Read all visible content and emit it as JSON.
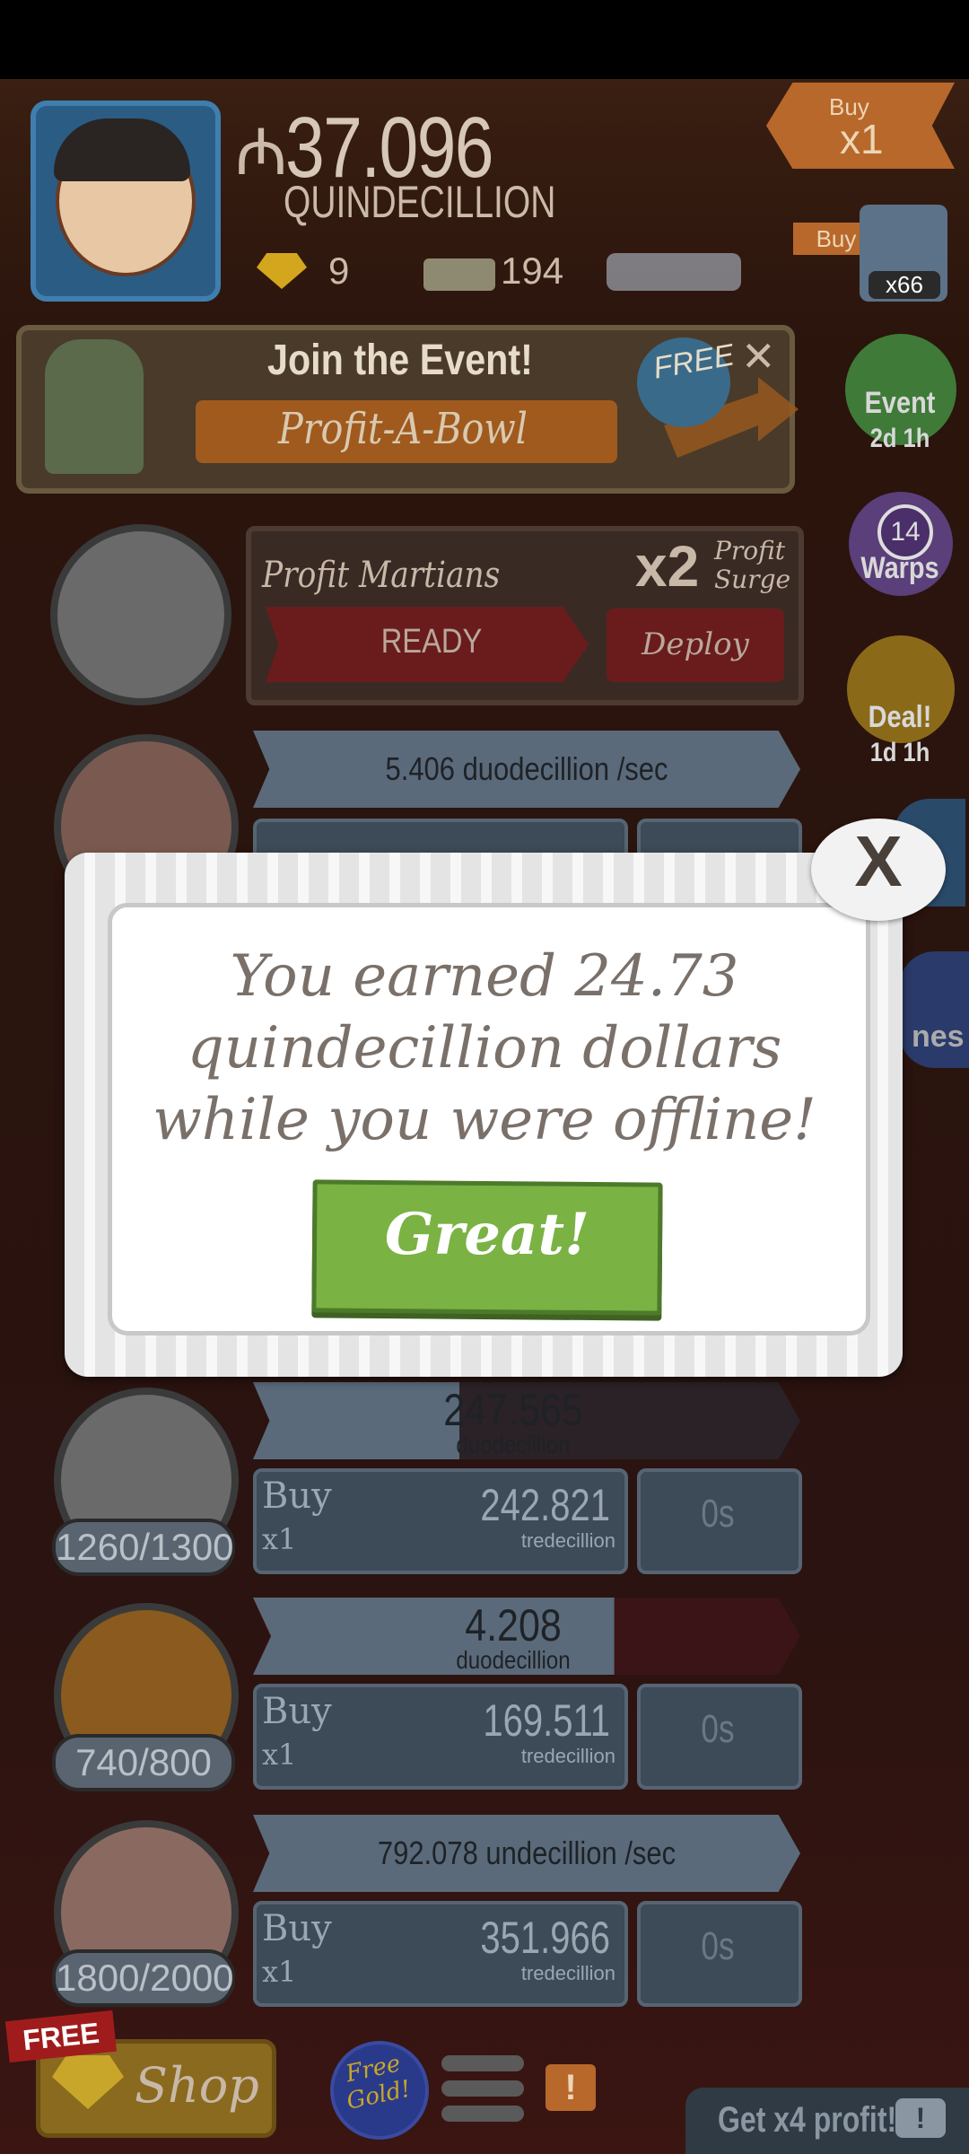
{
  "header": {
    "currency_symbol": "₼",
    "money_amount": "37.096",
    "money_unit": "QUINDECILLION",
    "gold_count": "9",
    "ticket_count": "194",
    "buy_tag_top": "Buy",
    "buy_tag_bottom": "x1",
    "buy_mini_label": "Buy",
    "buy_max_count": "x66"
  },
  "event_banner": {
    "title": "Join the Event!",
    "subtitle": "Profit-A-Bowl",
    "free_badge": "FREE",
    "close": "✕"
  },
  "side_menu": {
    "event_label": "Event",
    "event_time": "2d 1h",
    "warps_count": "14",
    "warps_label": "Warps",
    "deal_label": "Deal!",
    "deal_time": "1d 1h",
    "partial_label": "nes"
  },
  "martians": {
    "title": "Profit Martians",
    "surge_multiplier": "x2",
    "surge_line1": "Profit",
    "surge_line2": "Surge",
    "ready_label": "READY",
    "deploy_label": "Deploy"
  },
  "businesses": [
    {
      "rate": "5.406 duodecillion /sec"
    },
    {
      "rate_value": "247.565",
      "rate_unit": "duodecillion",
      "buy_word": "Buy",
      "buy_mult": "x1",
      "cost": "242.821",
      "cost_unit": "tredecillion",
      "time": "0s",
      "count": "1260/1300"
    },
    {
      "rate_value": "4.208",
      "rate_unit": "duodecillion",
      "buy_word": "Buy",
      "buy_mult": "x1",
      "cost": "169.511",
      "cost_unit": "tredecillion",
      "time": "0s",
      "count": "740/800",
      "progress": 0.66
    },
    {
      "rate": "792.078 undecillion /sec",
      "buy_word": "Buy",
      "buy_mult": "x1",
      "cost": "351.966",
      "cost_unit": "tredecillion",
      "time": "0s",
      "count": "1800/2000"
    }
  ],
  "popup": {
    "message": "You earned 24.73 quindecillion dollars while you were offline!",
    "confirm_label": "Great!",
    "close_label": "X"
  },
  "bottom_bar": {
    "shop_free_badge": "FREE",
    "shop_label": "Shop",
    "free_gold_label": "Free Gold!",
    "alert_label": "!",
    "profit_label": "Get x4 profit!",
    "tv_label": "!"
  }
}
